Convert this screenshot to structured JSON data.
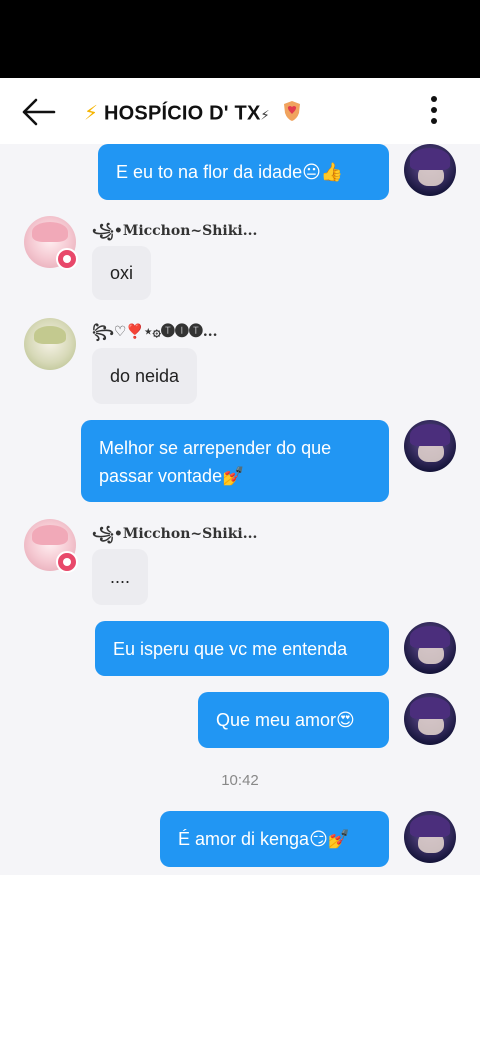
{
  "header": {
    "title": "HOSPÍCIO D' TX",
    "title_prefix_icon": "⚡",
    "title_suffix_icon": "⚡",
    "title_badge_icon": "shield-heart"
  },
  "colors": {
    "outgoing_bubble": "#2196f3",
    "incoming_bubble": "#ececf0",
    "chat_background": "#f5f5f8"
  },
  "messages": [
    {
      "from": "me",
      "text": "E eu to na flor da idade😐👍"
    },
    {
      "from": "other",
      "sender": "꧁•Micchon~Shiki...",
      "text": "oxi"
    },
    {
      "from": "other",
      "sender": "꧂♡❣️⋆۞🅣🅘🅣...",
      "text": "do neida"
    },
    {
      "from": "me",
      "text_lines": [
        "Melhor se arrepender do que",
        "passar vontade💅"
      ]
    },
    {
      "from": "other",
      "sender": "꧁•Micchon~Shiki...",
      "text": "...."
    },
    {
      "from": "me",
      "text": "Eu isperu que vc me entenda"
    },
    {
      "from": "me",
      "text": "Que meu amor😍"
    },
    {
      "timestamp": "10:42"
    },
    {
      "from": "me",
      "text": "É amor di kenga😏💅"
    }
  ]
}
